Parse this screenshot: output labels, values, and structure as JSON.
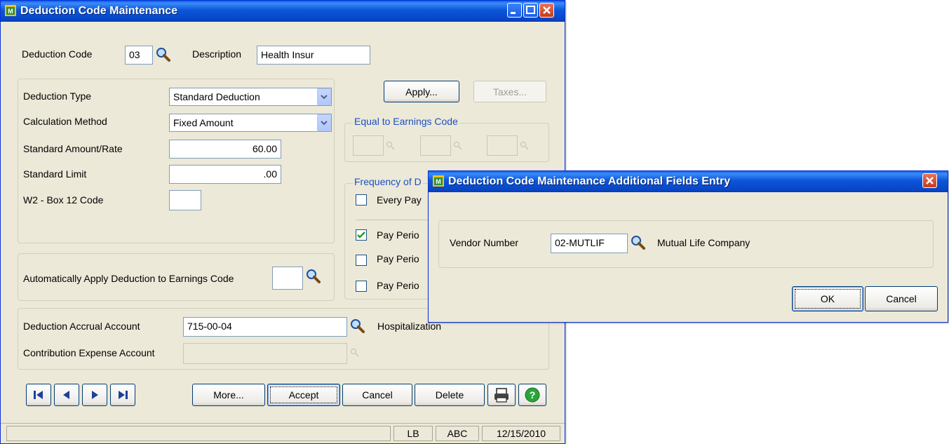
{
  "main_window": {
    "title": "Deduction Code Maintenance",
    "deduction_code": {
      "label": "Deduction Code",
      "value": "03"
    },
    "description": {
      "label": "Description",
      "value": "Health Insur"
    },
    "deduction_type": {
      "label": "Deduction Type",
      "value": "Standard Deduction"
    },
    "calculation_method": {
      "label": "Calculation Method",
      "value": "Fixed Amount"
    },
    "standard_amount": {
      "label": "Standard Amount/Rate",
      "value": "60.00"
    },
    "standard_limit": {
      "label": "Standard Limit",
      "value": ".00"
    },
    "w2_box12": {
      "label": "W2 - Box 12 Code",
      "value": ""
    },
    "auto_apply": {
      "label": "Automatically Apply Deduction to Earnings Code",
      "value": ""
    },
    "apply_button": "Apply...",
    "taxes_button": "Taxes...",
    "equal_to_earnings": {
      "title": "Equal to Earnings Code"
    },
    "frequency": {
      "title": "Frequency of D",
      "items": [
        {
          "label": "Every Pay",
          "checked": false
        },
        {
          "label": "Pay Perio",
          "checked": true
        },
        {
          "label": "Pay Perio",
          "checked": false
        },
        {
          "label": "Pay Perio",
          "checked": false
        }
      ]
    },
    "accrual_account": {
      "label": "Deduction Accrual Account",
      "value": "715-00-04",
      "desc": "Hospitalization"
    },
    "expense_account": {
      "label": "Contribution Expense Account",
      "value": ""
    },
    "buttons": {
      "more": "More...",
      "accept": "Accept",
      "cancel": "Cancel",
      "delete": "Delete"
    },
    "status": {
      "user": "LB",
      "company": "ABC",
      "date": "12/15/2010"
    }
  },
  "dialog": {
    "title": "Deduction Code Maintenance Additional Fields Entry",
    "vendor": {
      "label": "Vendor Number",
      "value": "02-MUTLIF",
      "name": "Mutual Life Company"
    },
    "ok": "OK",
    "cancel": "Cancel"
  }
}
